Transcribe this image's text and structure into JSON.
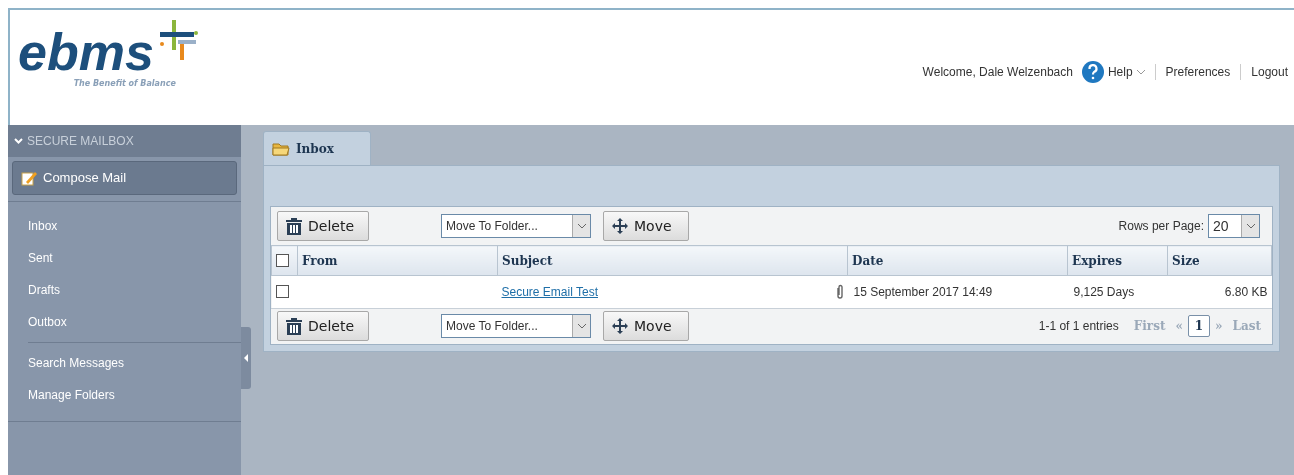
{
  "header": {
    "logo_text": "ebms",
    "tagline": "The Benefit of Balance",
    "welcome": "Welcome, Dale Welzenbach",
    "help": "Help",
    "links": [
      "Preferences",
      "Logout"
    ]
  },
  "sidebar": {
    "section_title": "SECURE MAILBOX",
    "expanded": true,
    "compose_button": "Compose Mail",
    "groups": [
      {
        "items": [
          "Inbox",
          "Sent",
          "Drafts",
          "Outbox"
        ]
      },
      {
        "items": [
          "Search Messages",
          "Manage Folders"
        ]
      }
    ]
  },
  "tabs": [
    {
      "label": "Inbox",
      "selected": true
    }
  ],
  "toolbars": [
    {
      "delete_button": "Delete",
      "move_select": "Move To Folder...",
      "move_button": "Move",
      "rows_label": "Rows per Page:",
      "rows_value": "20"
    },
    {
      "delete_button": "Delete",
      "move_select": "Move To Folder...",
      "move_button": "Move"
    }
  ],
  "table": {
    "all_checked": false,
    "columns": [
      "From",
      "Subject",
      "Date",
      "Expires",
      "Size"
    ],
    "rows": [
      {
        "checked": false,
        "subject": "Secure Email Test",
        "has_attachment": true,
        "date": "15 September 2017 14:49",
        "expires": "9,125 Days",
        "size": "6.80 KB"
      }
    ]
  },
  "pagination": {
    "summary": "1-1 of 1 entries",
    "first": {
      "label": "First",
      "disabled": true
    },
    "prev": {
      "label": "«",
      "disabled": true
    },
    "page": "1",
    "next": {
      "label": "»",
      "disabled": true
    },
    "last": {
      "label": "Last",
      "disabled": true
    }
  }
}
